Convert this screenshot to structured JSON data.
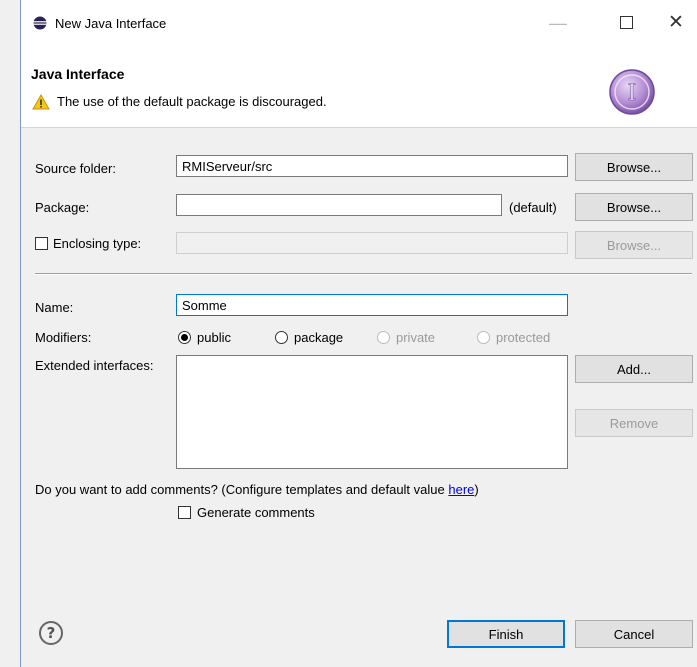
{
  "window": {
    "title": "New Java Interface",
    "app_icon": "eclipse-icon",
    "controls": {
      "minimize": "—",
      "close": "✕"
    }
  },
  "header": {
    "title": "Java Interface",
    "warning_icon": "warning-icon",
    "warning_message": "The use of the default package is discouraged.",
    "banner_icon": "interface-i-icon",
    "banner_letter": "I"
  },
  "form": {
    "source_folder": {
      "label": "Source folder:",
      "value": "RMIServeur/src",
      "browse_label": "Browse..."
    },
    "package": {
      "label": "Package:",
      "value": "",
      "default_label": "(default)",
      "browse_label": "Browse..."
    },
    "enclosing_type": {
      "label": "Enclosing type:",
      "checked": false,
      "value": "",
      "browse_label": "Browse..."
    },
    "name": {
      "label": "Name:",
      "value": "Somme"
    },
    "modifiers": {
      "label": "Modifiers:",
      "options": [
        {
          "label": "public",
          "selected": true,
          "enabled": true
        },
        {
          "label": "package",
          "selected": false,
          "enabled": true
        },
        {
          "label": "private",
          "selected": false,
          "enabled": false
        },
        {
          "label": "protected",
          "selected": false,
          "enabled": false
        }
      ]
    },
    "extended_interfaces": {
      "label": "Extended interfaces:",
      "add_label": "Add...",
      "remove_label": "Remove"
    },
    "comments": {
      "question": "Do you want to add comments? (Configure templates and default value ",
      "link": "here",
      "question_end": ")",
      "checkbox_label": "Generate comments",
      "checked": false
    }
  },
  "footer": {
    "help_icon": "help-icon",
    "help_glyph": "?",
    "finish_label": "Finish",
    "cancel_label": "Cancel"
  }
}
